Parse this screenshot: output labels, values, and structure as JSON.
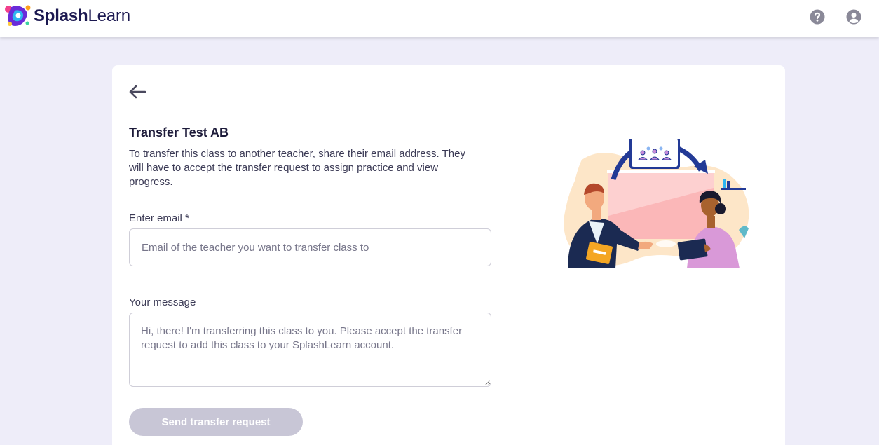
{
  "header": {
    "logo_bold": "Splash",
    "logo_light": "Learn",
    "help_icon": "question-circle-icon",
    "user_icon": "user-circle-icon"
  },
  "card": {
    "back_icon": "arrow-left-icon",
    "title": "Transfer Test AB",
    "description": "To transfer this class to another teacher, share their email address. They will have to accept the transfer request to assign practice and view progress.",
    "email_label": "Enter email *",
    "email_placeholder": "Email of the teacher you want to transfer class to",
    "email_value": "",
    "message_label": "Your message",
    "message_placeholder": "Hi, there! I'm transferring this class to you. Please accept the transfer request to add this class to your SplashLearn account.",
    "message_value": "",
    "send_label": "Send transfer request",
    "send_disabled": true
  },
  "colors": {
    "page_bg": "#eeedf9",
    "brand": "#1b1850",
    "button_disabled": "#c8c6d6",
    "icon_gray": "#8a8998"
  }
}
